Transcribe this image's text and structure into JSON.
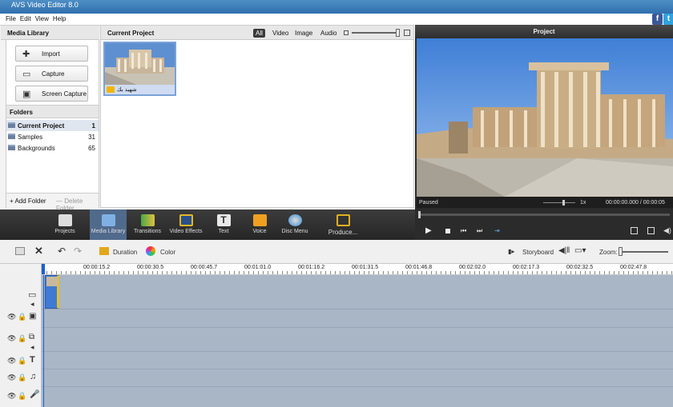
{
  "window": {
    "title": "AVS Video Editor 8.0"
  },
  "menu": [
    "File",
    "Edit",
    "View",
    "Help"
  ],
  "social": {
    "facebook": "f",
    "twitter": "t"
  },
  "media_library": {
    "header": "Media Library",
    "buttons": [
      {
        "label": "Import",
        "icon": "plus-icon"
      },
      {
        "label": "Capture",
        "icon": "camera-icon"
      },
      {
        "label": "Screen Capture",
        "icon": "screen-capture-icon"
      }
    ],
    "folders_header": "Folders",
    "folders": [
      {
        "name": "Current Project",
        "count": "1"
      },
      {
        "name": "Samples",
        "count": "31"
      },
      {
        "name": "Backgrounds",
        "count": "65"
      }
    ],
    "add_folder": "+ Add Folder",
    "delete_folder": "— Delete Folder"
  },
  "current_project": {
    "header": "Current Project",
    "filters": [
      "All",
      "Video",
      "Image",
      "Audio"
    ],
    "active_filter": "All",
    "thumb_label": "شهيد بك"
  },
  "preview": {
    "header": "Project",
    "status": "Paused",
    "speed": "1x",
    "time": "00:00:00.000 / 00:00:05"
  },
  "tools": [
    {
      "label": "Projects",
      "icon": "clapper-icon"
    },
    {
      "label": "Media Library",
      "icon": "media-library-icon"
    },
    {
      "label": "Transitions",
      "icon": "transitions-icon"
    },
    {
      "label": "Video Effects",
      "icon": "video-effects-icon"
    },
    {
      "label": "Text",
      "icon": "text-icon"
    },
    {
      "label": "Voice",
      "icon": "microphone-icon"
    },
    {
      "label": "Disc Menu",
      "icon": "disc-menu-icon"
    },
    {
      "label": "Produce...",
      "icon": "produce-icon"
    }
  ],
  "timeline_toolbar": {
    "duration": "Duration",
    "color": "Color",
    "storyboard": "Storyboard",
    "zoom": "Zoom:"
  },
  "ruler": [
    "00:00:15.2",
    "00:00:30.5",
    "00:00:45.7",
    "00:01:01.0",
    "00:01:16.2",
    "00:01:31.5",
    "00:01:46.8",
    "00:02:02.0",
    "00:02:17.3",
    "00:02:32.5",
    "00:02:47.8"
  ],
  "colors": {
    "accent": "#506a8c",
    "timeline": "#a8b6c6"
  }
}
